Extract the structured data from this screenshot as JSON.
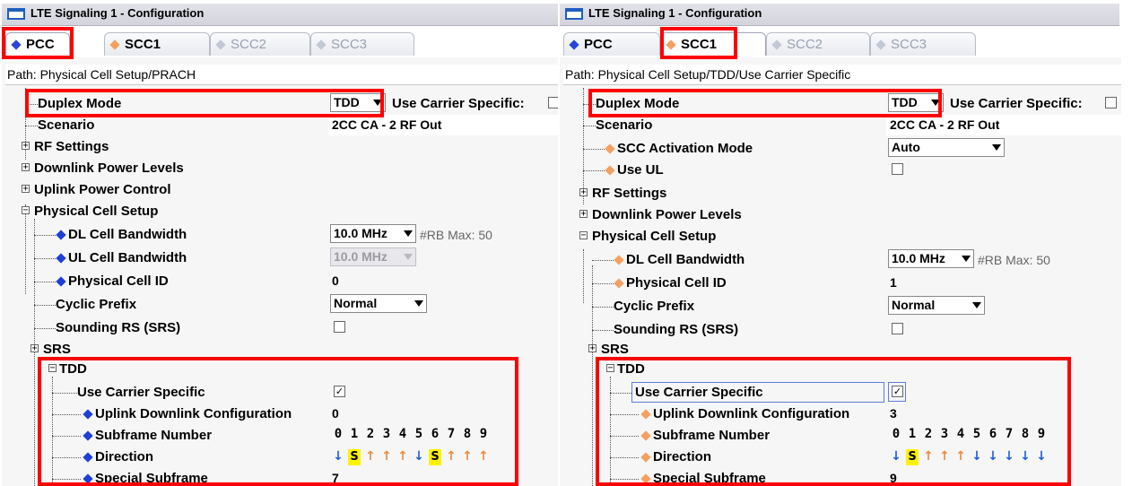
{
  "left": {
    "window_title": "LTE Signaling 1 - Configuration",
    "tabs": [
      "PCC",
      "SCC1",
      "SCC2",
      "SCC3"
    ],
    "path": "Path: Physical Cell Setup/PRACH",
    "rows": {
      "duplex_mode": "Duplex Mode",
      "duplex_value": "TDD",
      "use_carrier_specific_inline": "Use Carrier Specific:",
      "scenario": "Scenario",
      "scenario_value": "2CC CA - 2 RF Out",
      "rf_settings": "RF Settings",
      "downlink_power_levels": "Downlink Power Levels",
      "uplink_power_control": "Uplink Power Control",
      "physical_cell_setup": "Physical Cell Setup",
      "dl_cell_bandwidth": "DL Cell Bandwidth",
      "dl_bw_value": "10.0 MHz",
      "rb_max": "#RB Max:  50",
      "ul_cell_bandwidth": "UL Cell Bandwidth",
      "ul_bw_value": "10.0 MHz",
      "physical_cell_id": "Physical Cell ID",
      "physical_cell_id_value": "0",
      "cyclic_prefix": "Cyclic Prefix",
      "cyclic_prefix_value": "Normal",
      "sounding_rs": "Sounding RS (SRS)",
      "srs": "SRS",
      "tdd": "TDD",
      "use_carrier_specific": "Use Carrier Specific",
      "ul_dl_configuration": "Uplink Downlink Configuration",
      "ul_dl_configuration_value": "0",
      "subframe_number": "Subframe Number",
      "direction": "Direction",
      "special_subframe": "Special Subframe",
      "special_subframe_value": "7"
    },
    "subframes": [
      "0",
      "1",
      "2",
      "3",
      "4",
      "5",
      "6",
      "7",
      "8",
      "9"
    ],
    "directions": [
      "↓",
      "S",
      "↑",
      "↑",
      "↑",
      "↓",
      "S",
      "↑",
      "↑",
      "↑"
    ]
  },
  "right": {
    "window_title": "LTE Signaling 1 - Configuration",
    "tabs": [
      "PCC",
      "SCC1",
      "SCC2",
      "SCC3"
    ],
    "path": "Path: Physical Cell Setup/TDD/Use Carrier Specific",
    "rows": {
      "duplex_mode": "Duplex Mode",
      "duplex_value": "TDD",
      "use_carrier_specific_inline": "Use Carrier Specific:",
      "scenario": "Scenario",
      "scenario_value": "2CC CA - 2 RF Out",
      "scc_activation_mode": "SCC Activation Mode",
      "scc_activation_value": "Auto",
      "use_ul": "Use UL",
      "rf_settings": "RF Settings",
      "downlink_power_levels": "Downlink Power Levels",
      "physical_cell_setup": "Physical Cell Setup",
      "dl_cell_bandwidth": "DL Cell Bandwidth",
      "dl_bw_value": "10.0 MHz",
      "rb_max": "#RB Max:  50",
      "physical_cell_id": "Physical Cell ID",
      "physical_cell_id_value": "1",
      "cyclic_prefix": "Cyclic Prefix",
      "cyclic_prefix_value": "Normal",
      "sounding_rs": "Sounding RS (SRS)",
      "srs": "SRS",
      "tdd": "TDD",
      "use_carrier_specific": "Use Carrier Specific",
      "ul_dl_configuration": "Uplink Downlink Configuration",
      "ul_dl_configuration_value": "3",
      "subframe_number": "Subframe Number",
      "direction": "Direction",
      "special_subframe": "Special Subframe",
      "special_subframe_value": "9"
    },
    "subframes": [
      "0",
      "1",
      "2",
      "3",
      "4",
      "5",
      "6",
      "7",
      "8",
      "9"
    ],
    "directions": [
      "↓",
      "S",
      "↑",
      "↑",
      "↑",
      "↓",
      "↓",
      "↓",
      "↓",
      "↓"
    ]
  },
  "checkmark": "✓",
  "colors": {
    "highlight_red": "#ff0000",
    "tab_blue": "#2a46d8",
    "tab_orange": "#f4a060",
    "down_arrow": "#1f5fd8",
    "up_arrow": "#f08a3c",
    "special_yellow": "#fff200"
  }
}
